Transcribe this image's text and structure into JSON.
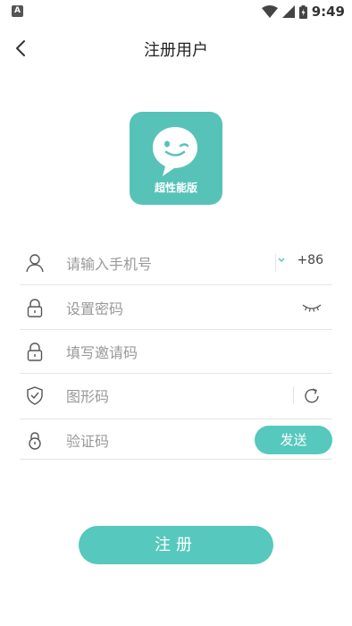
{
  "status_bar": {
    "time": "9:49",
    "left_icon_letter": "A",
    "icons": [
      "wifi-icon",
      "signal-icon",
      "battery-icon"
    ]
  },
  "header": {
    "title": "注册用户",
    "back_icon": "chevron-left-icon"
  },
  "logo": {
    "label": "超性能版",
    "color": "#57c2b8"
  },
  "form": {
    "phone": {
      "placeholder": "请输入手机号",
      "country_code": "+86",
      "icon": "user-icon"
    },
    "password": {
      "placeholder": "设置密码",
      "icon": "lock-icon",
      "toggle_icon": "eye-closed-icon"
    },
    "invite_code": {
      "placeholder": "填写邀请码",
      "icon": "lock-icon"
    },
    "captcha": {
      "placeholder": "图形码",
      "icon": "shield-icon",
      "refresh_icon": "refresh-icon"
    },
    "sms_code": {
      "placeholder": "验证码",
      "icon": "lock-icon",
      "send_label": "发送"
    }
  },
  "register_label": "注册",
  "colors": {
    "accent": "#56c8bd",
    "divider": "#e6e6e6",
    "placeholder": "#999999"
  }
}
